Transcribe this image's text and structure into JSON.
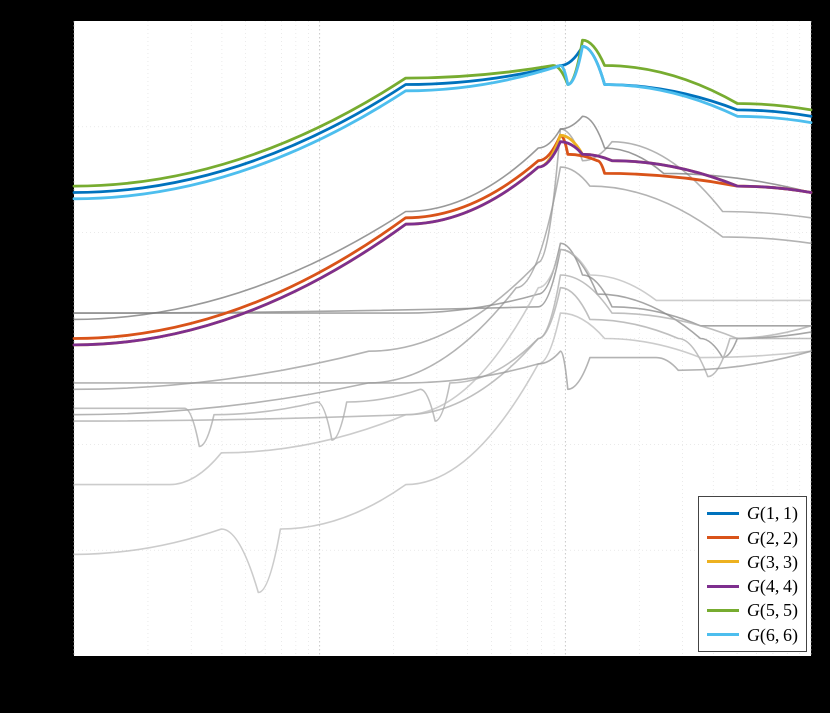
{
  "chart_data": {
    "type": "line",
    "title": "",
    "xlabel": "",
    "ylabel": "",
    "xscale": "log",
    "xlim_decades_shown": 3,
    "ylim": [
      -300,
      0
    ],
    "legend_position": "lower right",
    "series": [
      {
        "name": "G(1,1)",
        "color": "#0072bd",
        "approx_points_fraction": [
          [
            0.0,
            0.27
          ],
          [
            0.45,
            0.1
          ],
          [
            0.66,
            0.07
          ],
          [
            0.69,
            0.04
          ],
          [
            0.72,
            0.1
          ],
          [
            0.9,
            0.14
          ],
          [
            1.0,
            0.15
          ]
        ]
      },
      {
        "name": "G(2,2)",
        "color": "#d95319",
        "approx_points_fraction": [
          [
            0.0,
            0.5
          ],
          [
            0.45,
            0.31
          ],
          [
            0.63,
            0.22
          ],
          [
            0.66,
            0.18
          ],
          [
            0.67,
            0.21
          ],
          [
            0.71,
            0.22
          ],
          [
            0.72,
            0.24
          ],
          [
            0.9,
            0.26
          ],
          [
            1.0,
            0.27
          ]
        ]
      },
      {
        "name": "G(3,3)",
        "color": "#edb120",
        "approx_points_fraction": [
          [
            0.0,
            0.51
          ],
          [
            0.45,
            0.32
          ],
          [
            0.63,
            0.23
          ],
          [
            0.66,
            0.18
          ],
          [
            0.69,
            0.21
          ],
          [
            0.73,
            0.22
          ],
          [
            0.9,
            0.26
          ],
          [
            1.0,
            0.27
          ]
        ]
      },
      {
        "name": "G(4,4)",
        "color": "#7e2f8e",
        "approx_points_fraction": [
          [
            0.0,
            0.51
          ],
          [
            0.45,
            0.32
          ],
          [
            0.63,
            0.23
          ],
          [
            0.66,
            0.19
          ],
          [
            0.69,
            0.21
          ],
          [
            0.73,
            0.22
          ],
          [
            0.9,
            0.26
          ],
          [
            1.0,
            0.27
          ]
        ]
      },
      {
        "name": "G(5,5)",
        "color": "#77ac30",
        "approx_points_fraction": [
          [
            0.0,
            0.26
          ],
          [
            0.45,
            0.09
          ],
          [
            0.65,
            0.07
          ],
          [
            0.67,
            0.1
          ],
          [
            0.69,
            0.03
          ],
          [
            0.72,
            0.07
          ],
          [
            0.9,
            0.13
          ],
          [
            1.0,
            0.14
          ]
        ]
      },
      {
        "name": "G(6,6)",
        "color": "#4dbeee",
        "approx_points_fraction": [
          [
            0.0,
            0.28
          ],
          [
            0.45,
            0.11
          ],
          [
            0.66,
            0.07
          ],
          [
            0.67,
            0.1
          ],
          [
            0.69,
            0.04
          ],
          [
            0.72,
            0.1
          ],
          [
            0.9,
            0.15
          ],
          [
            1.0,
            0.16
          ]
        ]
      }
    ],
    "background_series": [
      {
        "color": "#999",
        "pts": [
          [
            0.0,
            0.58
          ],
          [
            0.4,
            0.52
          ],
          [
            0.63,
            0.38
          ],
          [
            0.66,
            0.17
          ],
          [
            0.69,
            0.22
          ],
          [
            0.73,
            0.19
          ],
          [
            0.88,
            0.3
          ],
          [
            1.0,
            0.31
          ]
        ]
      },
      {
        "color": "#999",
        "pts": [
          [
            0.0,
            0.62
          ],
          [
            0.4,
            0.57
          ],
          [
            0.6,
            0.42
          ],
          [
            0.66,
            0.23
          ],
          [
            0.7,
            0.26
          ],
          [
            0.88,
            0.34
          ],
          [
            1.0,
            0.35
          ]
        ]
      },
      {
        "color": "#888",
        "pts": [
          [
            0.0,
            0.46
          ],
          [
            0.45,
            0.46
          ],
          [
            0.63,
            0.43
          ],
          [
            0.66,
            0.35
          ],
          [
            0.69,
            0.4
          ],
          [
            0.73,
            0.45
          ],
          [
            0.85,
            0.48
          ],
          [
            1.0,
            0.48
          ]
        ]
      },
      {
        "color": "#888",
        "pts": [
          [
            0.0,
            0.46
          ],
          [
            0.63,
            0.45
          ],
          [
            0.66,
            0.36
          ],
          [
            0.71,
            0.43
          ],
          [
            0.85,
            0.5
          ],
          [
            0.88,
            0.53
          ],
          [
            0.9,
            0.5
          ],
          [
            1.0,
            0.49
          ]
        ]
      },
      {
        "color": "#aaa",
        "pts": [
          [
            0.0,
            0.61
          ],
          [
            0.15,
            0.61
          ],
          [
            0.17,
            0.67
          ],
          [
            0.19,
            0.62
          ],
          [
            0.33,
            0.6
          ],
          [
            0.35,
            0.66
          ],
          [
            0.37,
            0.6
          ],
          [
            0.47,
            0.58
          ],
          [
            0.49,
            0.63
          ],
          [
            0.51,
            0.57
          ],
          [
            0.63,
            0.5
          ],
          [
            0.66,
            0.4
          ],
          [
            0.73,
            0.46
          ],
          [
            0.9,
            0.5
          ],
          [
            1.0,
            0.5
          ]
        ]
      },
      {
        "color": "#aaa",
        "pts": [
          [
            0.0,
            0.63
          ],
          [
            0.45,
            0.62
          ],
          [
            0.63,
            0.5
          ],
          [
            0.66,
            0.42
          ],
          [
            0.7,
            0.47
          ],
          [
            0.82,
            0.5
          ],
          [
            0.86,
            0.56
          ],
          [
            0.89,
            0.5
          ],
          [
            1.0,
            0.48
          ]
        ]
      },
      {
        "color": "#bbb",
        "pts": [
          [
            0.0,
            0.73
          ],
          [
            0.13,
            0.73
          ],
          [
            0.2,
            0.68
          ],
          [
            0.45,
            0.62
          ],
          [
            0.63,
            0.42
          ],
          [
            0.66,
            0.36
          ],
          [
            0.7,
            0.4
          ],
          [
            0.79,
            0.44
          ],
          [
            1.0,
            0.44
          ]
        ]
      },
      {
        "color": "#bbb",
        "pts": [
          [
            0.0,
            0.84
          ],
          [
            0.2,
            0.8
          ],
          [
            0.25,
            0.9
          ],
          [
            0.28,
            0.8
          ],
          [
            0.45,
            0.73
          ],
          [
            0.63,
            0.54
          ],
          [
            0.66,
            0.46
          ],
          [
            0.72,
            0.5
          ],
          [
            0.85,
            0.53
          ],
          [
            1.0,
            0.52
          ]
        ]
      },
      {
        "color": "#777",
        "pts": [
          [
            0.0,
            0.47
          ],
          [
            0.45,
            0.3
          ],
          [
            0.63,
            0.2
          ],
          [
            0.66,
            0.17
          ],
          [
            0.69,
            0.15
          ],
          [
            0.72,
            0.2
          ],
          [
            0.8,
            0.24
          ],
          [
            1.0,
            0.27
          ]
        ]
      },
      {
        "color": "#999",
        "pts": [
          [
            0.0,
            0.57
          ],
          [
            0.45,
            0.57
          ],
          [
            0.63,
            0.54
          ],
          [
            0.66,
            0.52
          ],
          [
            0.67,
            0.58
          ],
          [
            0.7,
            0.53
          ],
          [
            0.79,
            0.53
          ],
          [
            0.82,
            0.55
          ],
          [
            1.0,
            0.52
          ]
        ]
      }
    ]
  },
  "legend": {
    "items": [
      {
        "label": "G(1,1)",
        "color": "#0072bd"
      },
      {
        "label": "G(2,2)",
        "color": "#d95319"
      },
      {
        "label": "G(3,3)",
        "color": "#edb120"
      },
      {
        "label": "G(4,4)",
        "color": "#7e2f8e"
      },
      {
        "label": "G(5,5)",
        "color": "#77ac30"
      },
      {
        "label": "G(6,6)",
        "color": "#4dbeee"
      }
    ]
  }
}
